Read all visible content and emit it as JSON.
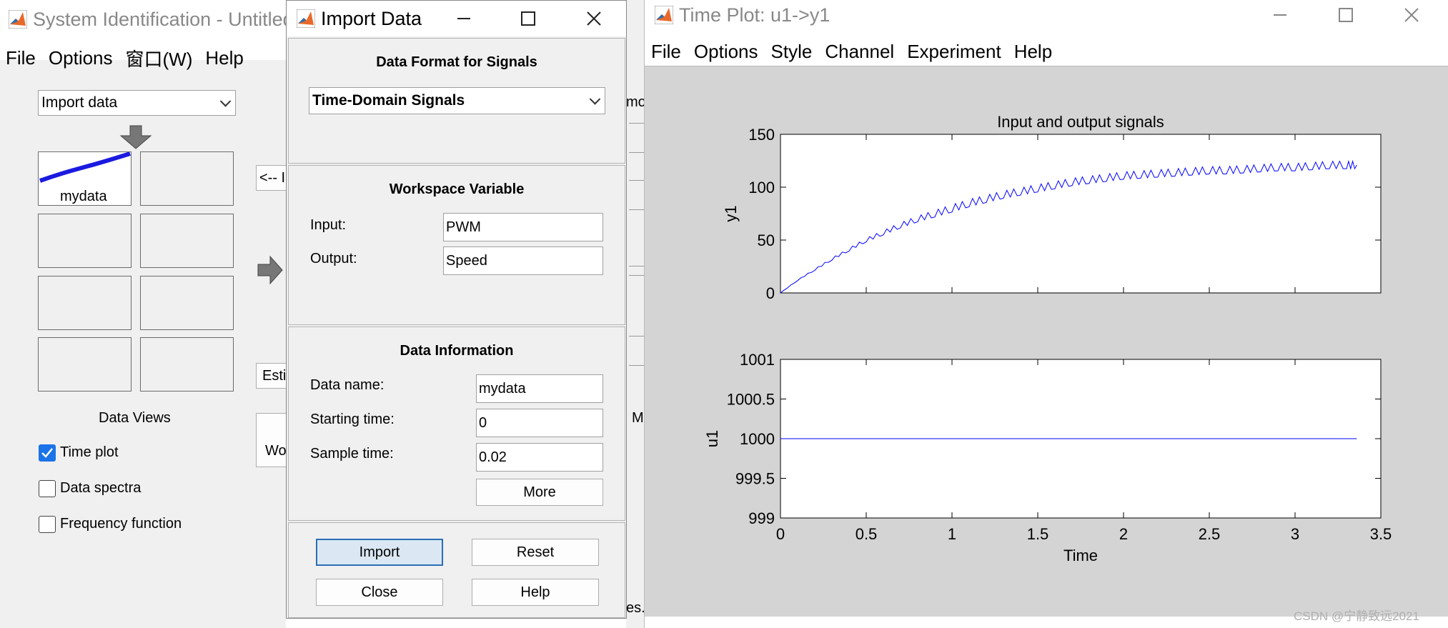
{
  "sysid": {
    "title": "System Identification - Untitled",
    "menu": [
      "File",
      "Options",
      "窗口(W)",
      "Help"
    ],
    "import_select": "Import data",
    "mydata_label": "mydata",
    "partial_buttons": {
      "import_left": "<-- I",
      "estimate": "Esti",
      "work": "Wo",
      "model_edge": "mo",
      "m_edge": "M",
      "es_edge": "es."
    },
    "data_views": "Data Views",
    "checkboxes": [
      {
        "label": "Time plot",
        "checked": true
      },
      {
        "label": "Data spectra",
        "checked": false
      },
      {
        "label": "Frequency function",
        "checked": false
      }
    ]
  },
  "import": {
    "title": "Import Data",
    "format_heading": "Data Format for Signals",
    "format_value": "Time-Domain Signals",
    "workspace_heading": "Workspace Variable",
    "input_label": "Input:",
    "input_value": "PWM",
    "output_label": "Output:",
    "output_value": "Speed",
    "info_heading": "Data Information",
    "data_name_label": "Data name:",
    "data_name_value": "mydata",
    "start_label": "Starting time:",
    "start_value": "0",
    "sample_label": "Sample time:",
    "sample_value": "0.02",
    "more": "More",
    "buttons": {
      "import": "Import",
      "reset": "Reset",
      "close": "Close",
      "help": "Help"
    }
  },
  "timeplot": {
    "title": "Time Plot: u1->y1",
    "menu": [
      "File",
      "Options",
      "Style",
      "Channel",
      "Experiment",
      "Help"
    ],
    "watermark": "CSDN @宁静致远2021"
  },
  "colors": {
    "window_bg": "#f0f0f0",
    "plot_bg": "#d4d4d4",
    "accent": "#1a73e8",
    "signal": "#0000ff"
  },
  "chart_data": [
    {
      "type": "line",
      "title": "Input and output signals",
      "xlabel": "",
      "ylabel": "y1",
      "xlim": [
        0,
        3.5
      ],
      "ylim": [
        0,
        150
      ],
      "xticks": [
        0,
        0.5,
        1,
        1.5,
        2,
        2.5,
        3,
        3.5
      ],
      "yticks": [
        0,
        50,
        100,
        150
      ],
      "series": [
        {
          "x": [
            0,
            0.1,
            0.2,
            0.3,
            0.4,
            0.5,
            0.6,
            0.7,
            0.8,
            0.9,
            1.0,
            1.1,
            1.2,
            1.3,
            1.4,
            1.5,
            1.6,
            1.7,
            1.8,
            1.9,
            2.0,
            2.1,
            2.2,
            2.3,
            2.4,
            2.5,
            2.6,
            2.7,
            2.8,
            2.9,
            3.0,
            3.1,
            3.2,
            3.3,
            3.36
          ],
          "y": [
            0,
            12,
            22,
            32,
            41,
            50,
            57,
            64,
            70,
            75,
            80,
            85,
            89,
            93,
            96,
            99,
            102,
            105,
            107,
            109,
            111,
            112,
            113,
            114,
            115,
            116,
            116,
            117,
            118,
            119,
            119,
            120,
            121,
            121,
            121
          ]
        }
      ]
    },
    {
      "type": "line",
      "title": "",
      "xlabel": "Time",
      "ylabel": "u1",
      "xlim": [
        0,
        3.5
      ],
      "ylim": [
        999,
        1001
      ],
      "xticks": [
        0,
        0.5,
        1,
        1.5,
        2,
        2.5,
        3,
        3.5
      ],
      "yticks": [
        999,
        999.5,
        1000,
        1000.5,
        1001
      ],
      "series": [
        {
          "x": [
            0,
            3.36
          ],
          "y": [
            1000,
            1000
          ]
        }
      ]
    }
  ]
}
